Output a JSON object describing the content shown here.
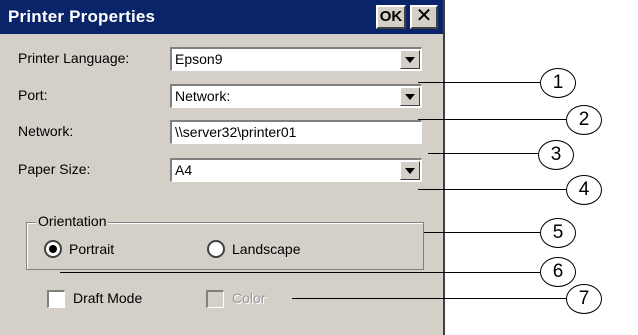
{
  "window": {
    "title": "Printer Properties",
    "ok_label": "OK",
    "close_glyph": "✕"
  },
  "form": {
    "printer_language": {
      "label": "Printer Language:",
      "value": "Epson9"
    },
    "port": {
      "label": "Port:",
      "value": "Network:"
    },
    "network": {
      "label": "Network:",
      "value": "\\\\server32\\printer01"
    },
    "paper_size": {
      "label": "Paper Size:",
      "value": "A4"
    }
  },
  "orientation": {
    "group_title": "Orientation",
    "portrait_label": "Portrait",
    "landscape_label": "Landscape",
    "selected": "Portrait"
  },
  "options": {
    "draft_mode_label": "Draft Mode",
    "draft_mode_checked": false,
    "color_label": "Color",
    "color_checked": false,
    "color_enabled": false
  },
  "callouts": [
    "1",
    "2",
    "3",
    "4",
    "5",
    "6",
    "7"
  ],
  "colors": {
    "titlebar": "#0a246a",
    "dialog_bg": "#d4d0c8"
  }
}
